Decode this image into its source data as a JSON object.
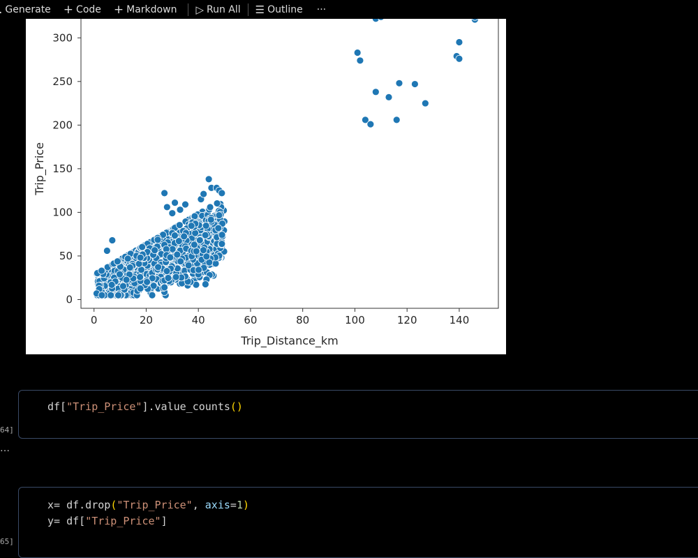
{
  "toolbar": {
    "generate": "Generate",
    "code": "Code",
    "markdown": "Markdown",
    "run_all": "Run All",
    "outline": "Outline",
    "more": "···",
    "icons": [
      "sparkle-icon",
      "plus-icon",
      "plus-icon",
      "run-all-icon",
      "outline-icon",
      "more-icon"
    ]
  },
  "output_ellipsis": "…",
  "cells": [
    {
      "exec_label": "64]",
      "lines": [
        [
          [
            "df[",
            "plain"
          ],
          [
            "\"Trip_Price\"",
            "str"
          ],
          [
            "].value_counts",
            "plain"
          ],
          [
            "()",
            "par"
          ]
        ]
      ]
    },
    {
      "exec_label": "65]",
      "lines": [
        [
          [
            "x= df.drop",
            "plain"
          ],
          [
            "(",
            "par"
          ],
          [
            "\"Trip_Price\"",
            "str"
          ],
          [
            ", ",
            "plain"
          ],
          [
            "axis",
            "kw"
          ],
          [
            "=",
            "plain"
          ],
          [
            "1",
            "num"
          ],
          [
            ")",
            "par"
          ]
        ],
        [
          [
            "y= df[",
            "plain"
          ],
          [
            "\"Trip_Price\"",
            "str"
          ],
          [
            "]",
            "plain"
          ]
        ]
      ]
    }
  ],
  "chart_data": {
    "type": "scatter",
    "xlabel": "Trip_Distance_km",
    "ylabel": "Trip_Price",
    "xlim": [
      -5,
      155
    ],
    "ylim": [
      -10,
      325
    ],
    "xticks": [
      0,
      20,
      40,
      60,
      80,
      100,
      120,
      140
    ],
    "yticks": [
      0,
      50,
      100,
      150,
      200,
      250,
      300
    ],
    "point_color": "#1f77b4",
    "cluster": {
      "description_x_range": [
        1,
        50
      ],
      "approx_price_range": [
        5,
        140
      ],
      "approx_trend": "price ≈ 20 + 1.1 × distance"
    },
    "outliers": [
      [
        101,
        283
      ],
      [
        102,
        274
      ],
      [
        104,
        206
      ],
      [
        106,
        201
      ],
      [
        108,
        238
      ],
      [
        108,
        322
      ],
      [
        110,
        324
      ],
      [
        113,
        232
      ],
      [
        116,
        206
      ],
      [
        117,
        248
      ],
      [
        123,
        247
      ],
      [
        127,
        225
      ],
      [
        139,
        279
      ],
      [
        140,
        276
      ],
      [
        140,
        295
      ],
      [
        146,
        321
      ],
      [
        146,
        324
      ]
    ],
    "cluster_extremes": [
      [
        27,
        122
      ],
      [
        28,
        106
      ],
      [
        30,
        99
      ],
      [
        31,
        111
      ],
      [
        33,
        103
      ],
      [
        35,
        109
      ],
      [
        41,
        115
      ],
      [
        42,
        121
      ],
      [
        44,
        138
      ],
      [
        45,
        128
      ],
      [
        47,
        128
      ],
      [
        48,
        125
      ],
      [
        49,
        122
      ],
      [
        7,
        68
      ],
      [
        5,
        56
      ],
      [
        2,
        12
      ],
      [
        1,
        7
      ],
      [
        3,
        5
      ],
      [
        27,
        14
      ]
    ]
  }
}
